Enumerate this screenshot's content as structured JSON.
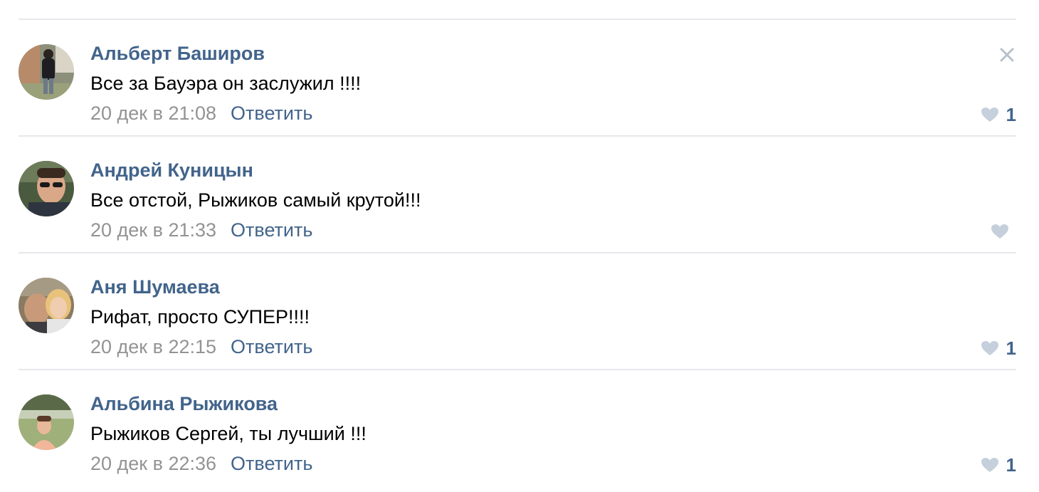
{
  "comments": [
    {
      "author": "Альберт Баширов",
      "text": "Все за Бауэра он заслужил !!!!",
      "date": "20 дек в 21:08",
      "reply_label": "Ответить",
      "likes": "1",
      "avatar": "avatar-photo",
      "has_close": true
    },
    {
      "author": "Андрей Куницын",
      "text": "Все отстой, Рыжиков самый крутой!!!",
      "date": "20 дек в 21:33",
      "reply_label": "Ответить",
      "likes": "",
      "avatar": "avatar-photo",
      "has_close": false
    },
    {
      "author": "Аня Шумаева",
      "text": "Рифат, просто СУПЕР!!!!",
      "date": "20 дек в 22:15",
      "reply_label": "Ответить",
      "likes": "1",
      "avatar": "avatar-photo",
      "has_close": false
    },
    {
      "author": "Альбина Рыжикова",
      "text": "Рыжиков Сергей, ты лучший !!!",
      "date": "20 дек в 22:36",
      "reply_label": "Ответить",
      "likes": "1",
      "avatar": "avatar-photo",
      "has_close": false
    }
  ],
  "icons": {
    "like": "heart-icon",
    "close": "close-icon"
  },
  "colors": {
    "link": "#42648b",
    "date": "#939393",
    "heart": "#c5d0dc",
    "divider": "#e7e8ec"
  }
}
